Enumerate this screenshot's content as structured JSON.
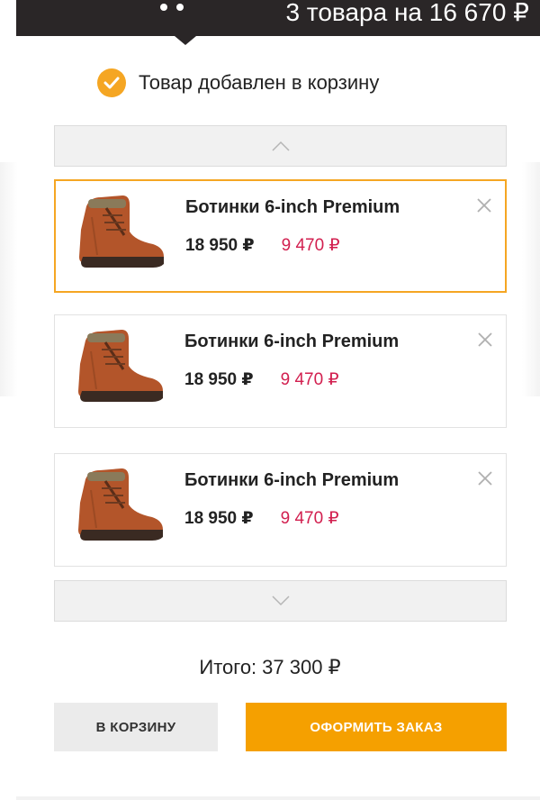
{
  "header": {
    "summary": "3 товара на 16 670 ₽"
  },
  "notice": {
    "text": "Товар добавлен в корзину",
    "icon": "check-circle-icon"
  },
  "products": [
    {
      "name": "Ботинки 6-inch Premium",
      "old_price": "18 950 ₽",
      "new_price": "9 470 ₽",
      "active": true
    },
    {
      "name": "Ботинки 6-inch Premium",
      "old_price": "18 950 ₽",
      "new_price": "9 470 ₽",
      "active": false
    },
    {
      "name": "Ботинки 6-inch Premium",
      "old_price": "18 950 ₽",
      "new_price": "9 470 ₽",
      "active": false
    }
  ],
  "total": {
    "label": "Итого:",
    "value": "37 300 ₽"
  },
  "buttons": {
    "cart_label": "В КОРЗИНУ",
    "order_label": "ОФОРМИТЬ ЗАКАЗ"
  },
  "colors": {
    "accent": "#f5a623",
    "order_button": "#f5a000",
    "sale_price": "#d21f4f",
    "header_bg": "#2a2627"
  }
}
